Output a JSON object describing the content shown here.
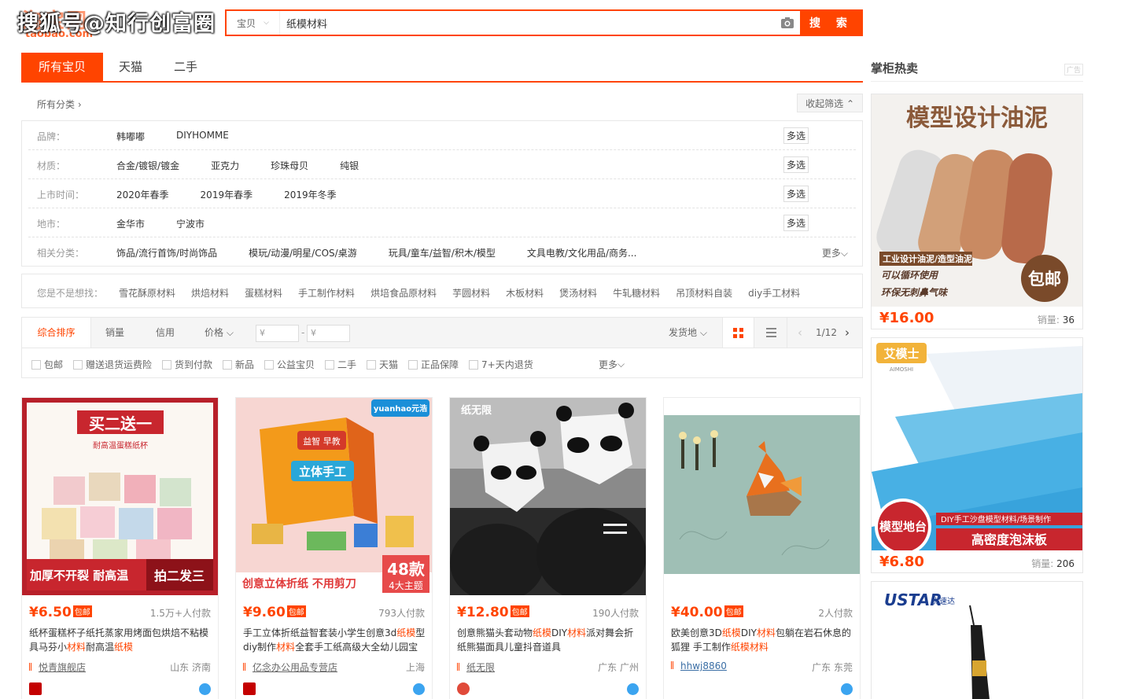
{
  "header": {
    "logo_cn": "淘宝网",
    "logo_en": "taobao.com",
    "watermark": "搜狐号@知行创富圈",
    "search_category": "宝贝",
    "search_query": "纸模材料",
    "search_button": "搜 索"
  },
  "tabs": [
    "所有宝贝",
    "天猫",
    "二手"
  ],
  "side_title": "掌柜热卖",
  "side_ad_tag": "广告",
  "filters": {
    "all_category": "所有分类 ›",
    "collapse": "收起筛选 ⌃",
    "multi": "多选",
    "more": "更多",
    "rows": [
      {
        "label": "品牌：",
        "values": [
          "韩嘟嘟",
          "DIYHOMME"
        ]
      },
      {
        "label": "材质：",
        "values": [
          "合金/镀银/镀金",
          "亚克力",
          "珍珠母贝",
          "纯银"
        ]
      },
      {
        "label": "上市时间：",
        "values": [
          "2020年春季",
          "2019年春季",
          "2019年冬季"
        ]
      },
      {
        "label": "地市：",
        "values": [
          "金华市",
          "宁波市"
        ]
      },
      {
        "label": "相关分类：",
        "values": [
          "饰品/流行首饰/时尚饰品",
          "模玩/动漫/明星/COS/桌游",
          "玩具/童车/益智/积木/模型",
          "文具电教/文化用品/商务..."
        ]
      }
    ],
    "guess_label": "您是不是想找：",
    "guess": [
      "雪花酥原材料",
      "烘焙材料",
      "蛋糕材料",
      "手工制作材料",
      "烘培食品原材料",
      "芋圆材料",
      "木板材料",
      "煲汤材料",
      "牛轧糖材料",
      "吊顶材料自装",
      "diy手工材料"
    ]
  },
  "sort": {
    "items": [
      "综合排序",
      "销量",
      "信用",
      "价格"
    ],
    "price_from": "¥",
    "price_to": "¥",
    "ship": "发货地",
    "page": "1/12"
  },
  "checks": [
    "包邮",
    "赠送退货运费险",
    "货到付款",
    "新品",
    "公益宝贝",
    "二手",
    "天猫",
    "正品保障",
    "7+天内退货"
  ],
  "checks_more": "更多",
  "products": [
    {
      "price": "¥6.50",
      "tag": "包邮",
      "count": "1.5万+人付款",
      "title": [
        "纸杯蛋糕杯子纸托蒸家用烤面包烘焙不粘模具马芬小",
        "材料",
        "耐高温",
        "纸模"
      ],
      "shop": "悦青旗舰店",
      "loc": "山东 济南",
      "banner_top": "买二送一",
      "banner_sub": "耐高温蛋糕纸杯",
      "banner_l": "加厚不开裂 耐高温",
      "banner_r": "拍二发三"
    },
    {
      "price": "¥9.60",
      "tag": "包邮",
      "count": "793人付款",
      "title": [
        "手工立体折纸益智套装小学生创意3d",
        "纸模",
        "型diy制作",
        "材料",
        "全套手工纸高级大全幼儿园宝"
      ],
      "shop": "亿念办公用品专营店",
      "loc": "上海",
      "brand": "yuanhao元浩",
      "box": "立体手工",
      "box2": "益智 早教",
      "banner": "创意立体折纸 不用剪刀",
      "badge": "48款",
      "badge2": "4大主题"
    },
    {
      "price": "¥12.80",
      "tag": "包邮",
      "count": "190人付款",
      "title": [
        "创意熊猫头套动物",
        "纸模",
        "DIY",
        "材料",
        "派对舞会折纸熊猫面具儿童抖音道具"
      ],
      "shop": "纸无限",
      "loc": "广东 广州",
      "brand": "纸无限"
    },
    {
      "price": "¥40.00",
      "tag": "包邮",
      "count": "2人付款",
      "title": [
        "欧美创意3D",
        "纸模",
        "DIY",
        "材料",
        "包躺在岩石休息的狐狸 手工制作",
        "纸模材料"
      ],
      "shop": "hhwj8860",
      "loc": "广东 东莞"
    }
  ],
  "ads": [
    {
      "headline": "模型设计油泥",
      "l1": "工业设计油泥/造型油泥",
      "l2": "可以循环使用",
      "l3": "环保无刺鼻气味",
      "stamp": "包邮",
      "price": "¥16.00",
      "sold_label": "销量:",
      "sold": "36"
    },
    {
      "brand": "艾模士",
      "brand_en": "AIMOSHI",
      "badge": "模型地台",
      "line": "DIY手工沙盘模型材料/场景制作",
      "banner": "高密度泡沫板",
      "price": "¥6.80",
      "sold_label": "销量:",
      "sold": "206"
    },
    {
      "brand": "USTAR",
      "brand_cn": "优速达"
    }
  ],
  "colors": {
    "accent": "#ff4400"
  }
}
